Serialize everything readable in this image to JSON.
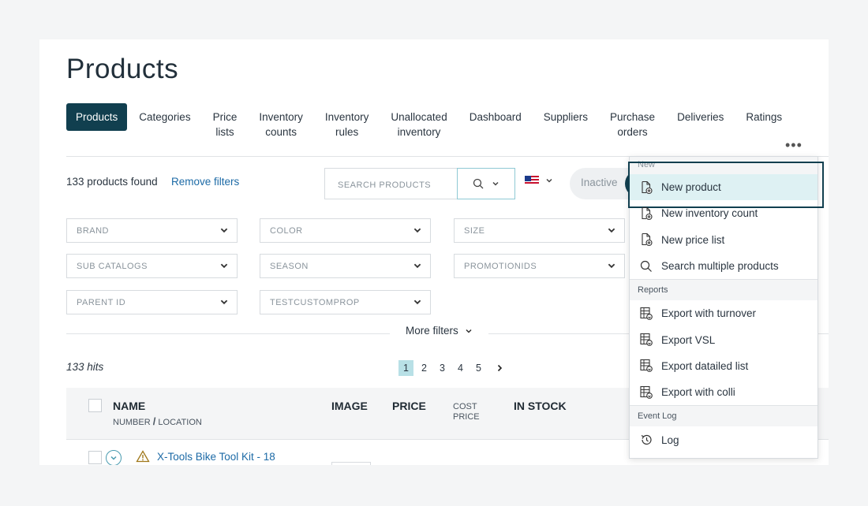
{
  "page": {
    "title": "Products"
  },
  "tabs": [
    {
      "label": "Products",
      "active": true
    },
    {
      "label": "Categories"
    },
    {
      "label": "Price\nlists"
    },
    {
      "label": "Inventory\ncounts"
    },
    {
      "label": "Inventory\nrules"
    },
    {
      "label": "Unallocated\ninventory"
    },
    {
      "label": "Dashboard"
    },
    {
      "label": "Suppliers"
    },
    {
      "label": "Purchase\norders"
    },
    {
      "label": "Deliveries"
    },
    {
      "label": "Ratings"
    }
  ],
  "more_icon": "•••",
  "toolbar": {
    "found_text": "133 products found",
    "remove_filters": "Remove filters",
    "search_placeholder": "SEARCH PRODUCTS",
    "search_icon": "search-icon",
    "country_flag": "us-flag-icon",
    "inactive_label": "Inactive"
  },
  "filters": [
    {
      "label": "BRAND"
    },
    {
      "label": "COLOR"
    },
    {
      "label": "SIZE"
    },
    {
      "label": "SUB CATALOGS"
    },
    {
      "label": "SEASON"
    },
    {
      "label": "PROMOTIONIDS"
    },
    {
      "label": "PARENT ID"
    },
    {
      "label": "TESTCUSTOMPROP"
    }
  ],
  "more_filters": "More filters",
  "results": {
    "hits": "133 hits",
    "pages": [
      "1",
      "2",
      "3",
      "4",
      "5"
    ],
    "current_page": "1",
    "next_icon": "chevron-right-icon"
  },
  "table": {
    "columns": {
      "name": "NAME",
      "name_sub_number": "NUMBER",
      "name_sub_sep": "/",
      "name_sub_location": "LOCATION",
      "image": "IMAGE",
      "price": "PRICE",
      "cost_price_line1": "COST",
      "cost_price_line2": "PRICE",
      "in_stock": "IN STOCK"
    },
    "rows": [
      {
        "name": "X-Tools Bike Tool Kit - 18",
        "warning": true
      }
    ]
  },
  "menu": {
    "sections": [
      {
        "title": "New",
        "items": [
          {
            "label": "New product",
            "icon": "new-document-icon",
            "highlighted": true
          },
          {
            "label": "New inventory count",
            "icon": "new-document-icon"
          },
          {
            "label": "New price list",
            "icon": "new-document-icon"
          },
          {
            "label": "Search multiple products",
            "icon": "search-icon"
          }
        ]
      },
      {
        "title": "Reports",
        "items": [
          {
            "label": "Export with turnover",
            "icon": "spreadsheet-export-icon"
          },
          {
            "label": "Export VSL",
            "icon": "spreadsheet-export-icon"
          },
          {
            "label": "Export datailed list",
            "icon": "spreadsheet-export-icon"
          },
          {
            "label": "Export with colli",
            "icon": "spreadsheet-export-icon"
          }
        ]
      },
      {
        "title": "Event Log",
        "items": [
          {
            "label": "Log",
            "icon": "history-icon"
          }
        ]
      }
    ]
  },
  "colors": {
    "accent_dark": "#113f4f",
    "link": "#1c6aa6",
    "highlight": "#def1f3",
    "page_current": "#b8e0e6"
  }
}
